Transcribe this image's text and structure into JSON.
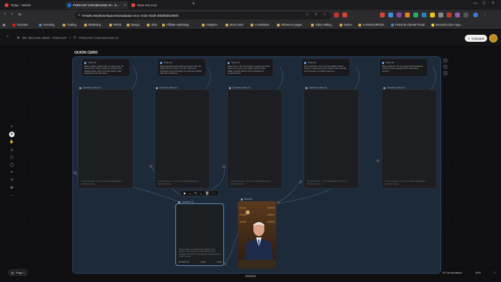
{
  "browser": {
    "tabs": [
      {
        "label": "Today – Todoist",
        "color": "#e44332"
      },
      {
        "label": "PODCAST CON MICHAEL M – S...",
        "color": "#1d6ce0"
      },
      {
        "label": "Team Ana Cruz",
        "color": "#e84a3c"
      }
    ],
    "url": "freepik.es/pikaso/spaces/a1a3aaa1-4c1c-4c8c-91d0-d80d5d516680",
    "bookmarks": [
      {
        "label": "YouTube",
        "color": "#e62117"
      },
      {
        "label": "Investing",
        "color": "#5b7bd5"
      },
      {
        "label": "Trading",
        "color": "#d6a84a"
      },
      {
        "label": "Marketing",
        "color": "#d6a84a"
      },
      {
        "label": "RRSS",
        "color": "#d6a84a"
      },
      {
        "label": "Design",
        "color": "#d6a84a"
      },
      {
        "label": "Jobs",
        "color": "#d6a84a"
      },
      {
        "label": "Affiliate marketing",
        "color": "#d6a84a"
      },
      {
        "label": "Analytics",
        "color": "#d6a84a"
      },
      {
        "label": "Most Used",
        "color": "#d6a84a"
      },
      {
        "label": "AI websites",
        "color": "#d6a84a"
      },
      {
        "label": "Influencer pages",
        "color": "#d6a84a"
      },
      {
        "label": "Video editing",
        "color": "#d6a84a"
      },
      {
        "label": "Notion",
        "color": "#d6a84a"
      },
      {
        "label": "AI RESOURCES",
        "color": "#d6a84a"
      },
      {
        "label": "Portal de Cliente Fiscal",
        "color": "#3a8bd8"
      },
      {
        "label": "Mercado Libre Arge...",
        "color": "#f2d53c"
      }
    ]
  },
  "app": {
    "breadcrumb": [
      "DR. MICHAEL MERI - PODCAST",
      "PODCAST CON MICHAEL M."
    ],
    "share_label": "Compartir",
    "page_title": "GUION CERO",
    "text_node_label": "Texto #1",
    "video_node_label": "Generar video #1",
    "text_nodes": [
      "Close medium portrait video of a warm man, Dr. Michael Meri, bright, seated in a professional podcast studio, warm cinematic lighting, dark background with soft bokeh...",
      "Same wardrobe and location and scene. The man slightly tilts his head to one side, softens his expression and nods slowly, his eyebrows relaxing with calm confidence...",
      "Same scene. The man begins to speak more freely, adjusts his posture very subtly. Camera holds stable; the light softens and the background remains blurred...",
      "Same wardrobe. The man leans slightly toward forward, increasing intensity. Hands move naturally and controlled, a confident presence...",
      "Same wardrobe. The man leans back his delivery, reinforcing the message with the right hand, pausing..."
    ],
    "video_prompt_placeholder": "Prompt opcional... Los @ para añadir referencias o instruccio-ciones",
    "floating_toolbar": [
      "▶",
      "⌄",
      "✎",
      "⌄",
      "🗑",
      "⋯"
    ],
    "last_node": {
      "label": "Lanzado #1",
      "prompt": "Same location. Dr. Michael Mer speaks to the camera. Calm and close, slowly delivering his message. A friendly, knowledgeable and lively tone in a warm setting.",
      "duration": "Duration 5s",
      "model": "Kling",
      "action": "Crear"
    },
    "image_node_label": "Michael",
    "page_button": "Page 1",
    "feedback": "Get feedback",
    "zoom": "34%"
  }
}
